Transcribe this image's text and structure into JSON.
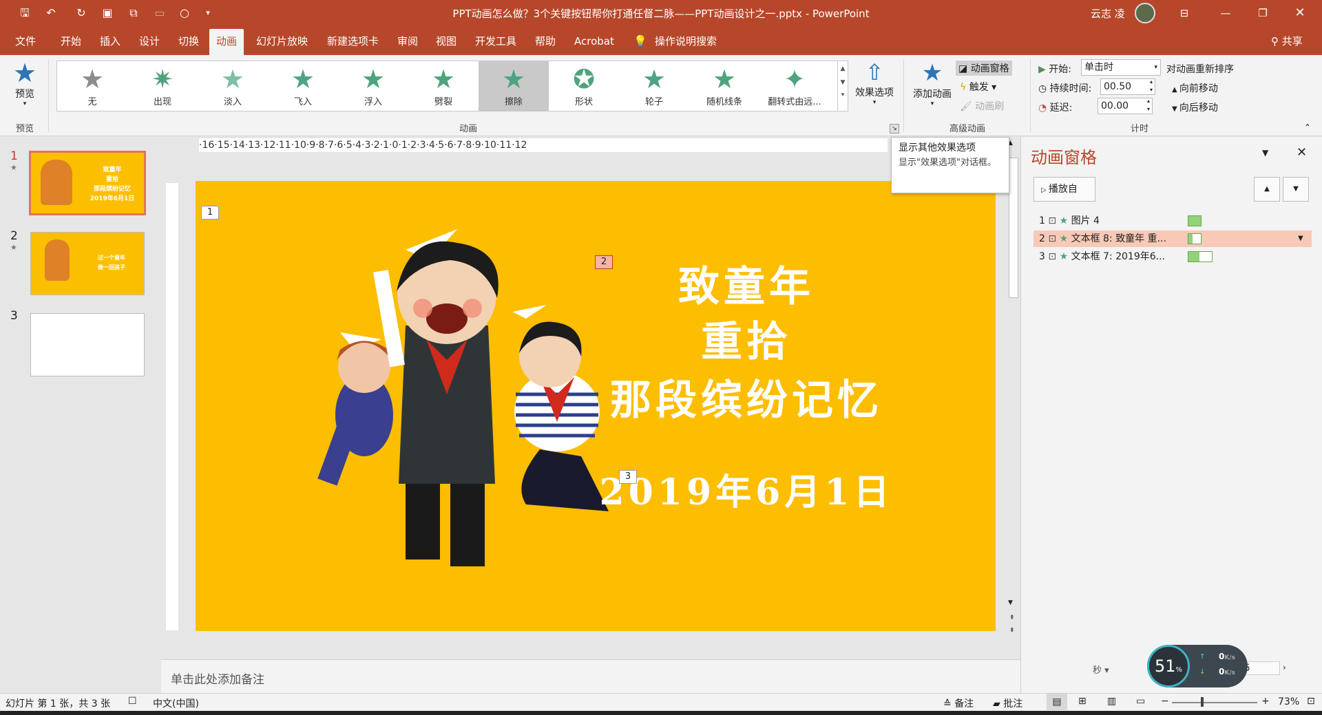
{
  "titlebar": {
    "title": "PPT动画怎么做？3个关键按钮帮你打通任督二脉——PPT动画设计之一.pptx  -  PowerPoint",
    "user": "云志 凌"
  },
  "tabs": [
    "文件",
    "开始",
    "插入",
    "设计",
    "切换",
    "动画",
    "幻灯片放映",
    "新建选项卡",
    "审阅",
    "视图",
    "开发工具",
    "帮助",
    "Acrobat",
    "操作说明搜索"
  ],
  "share": "共享",
  "ribbon": {
    "preview_label": "预览",
    "preview_group": "预览",
    "gallery": [
      "无",
      "出现",
      "淡入",
      "飞入",
      "浮入",
      "劈裂",
      "擦除",
      "形状",
      "轮子",
      "随机线条",
      "翻转式由远..."
    ],
    "effect_options": "效果选项",
    "anim_group": "动画",
    "add_anim": "添加动画",
    "anim_pane_btn": "动画窗格",
    "trigger": "触发",
    "anim_painter": "动画刷",
    "adv_group": "高级动画",
    "start_label": "开始:",
    "start_value": "单击时",
    "duration_label": "持续时间:",
    "duration_value": "00.50",
    "delay_label": "延迟:",
    "delay_value": "00.00",
    "reorder_label": "对动画重新排序",
    "move_earlier": "向前移动",
    "move_later": "向后移动",
    "timing_group": "计时"
  },
  "tooltip": {
    "title": "显示其他效果选项",
    "body": "显示\"效果选项\"对话框。"
  },
  "ruler_text": "·16·15·14·13·12·11·10·9·8·7·6·5·4·3·2·1·0·1·2·3·4·5·6·7·8·9·10·11·12",
  "slides": [
    {
      "num": "1",
      "star": "★",
      "line1": "致童年",
      "line2": "重拾",
      "line3": "那段缤纷记忆",
      "line4": "2019年6月1日"
    },
    {
      "num": "2",
      "star": "★",
      "line1": "过一个童年",
      "line2": "做一回孩子"
    },
    {
      "num": "3",
      "star": ""
    }
  ],
  "slide_content": {
    "line1": "致童年",
    "line2": "重拾",
    "line3": "那段缤纷记忆",
    "line4": "2019年6月1日",
    "tag1": "1",
    "tag2": "2",
    "tag3": "3"
  },
  "notes_placeholder": "单击此处添加备注",
  "anim_pane": {
    "title": "动画窗格",
    "play_btn": "播放自",
    "items": [
      {
        "num": "1",
        "name": "图片 4"
      },
      {
        "num": "2",
        "name": "文本框 8: 致童年 重..."
      },
      {
        "num": "3",
        "name": "文本框 7: 2019年6..."
      }
    ],
    "seconds": "秒",
    "timeline_value": "6"
  },
  "status": {
    "slide_info": "幻灯片 第 1 张，共 3 张",
    "language": "中文(中国)",
    "notes": "备注",
    "comments": "批注",
    "zoom": "73%"
  },
  "speed_widget": {
    "percent": "51",
    "percent_unit": "%",
    "up": "0",
    "down": "0",
    "unit": "K/s"
  },
  "colors": {
    "accent": "#b7472a",
    "slide_bg": "#fdbd00",
    "anim_star": "#4fa37e"
  }
}
